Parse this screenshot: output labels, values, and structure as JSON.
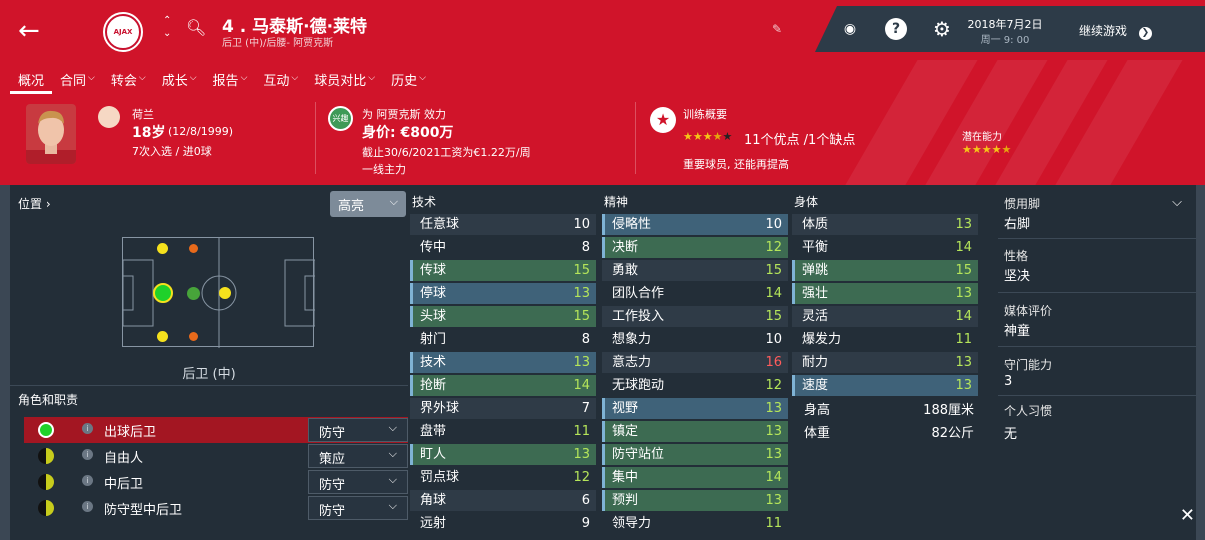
{
  "player": {
    "number_name": "4 . 马泰斯·德·莱特",
    "subtitle": "后卫 (中)/后腰- 阿贾克斯",
    "nationality": "荷兰",
    "age": "18岁",
    "dob": "(12/8/1999)",
    "caps": "7次入选 / 进0球",
    "club_line": "为 阿贾克斯 效力",
    "value": "身价: €800万",
    "contract": "截止30/6/2021工资为€1.22万/周",
    "squad_status": "一线主力",
    "club_badge_text": "兴趣"
  },
  "topbar": {
    "date": "2018年7月2日",
    "time": "周一 9: 00",
    "continue_label": "继续游戏"
  },
  "menu": [
    {
      "label": "概况",
      "active": true
    },
    {
      "label": "合同",
      "caret": true
    },
    {
      "label": "转会",
      "caret": true
    },
    {
      "label": "成长",
      "caret": true
    },
    {
      "label": "报告",
      "caret": true
    },
    {
      "label": "互动",
      "caret": true
    },
    {
      "label": "球员对比",
      "caret": true
    },
    {
      "label": "历史",
      "caret": true
    }
  ],
  "training": {
    "title": "训练概要",
    "summary": "11个优点 /1个缺点",
    "note": "重要球员, 还能再提高",
    "stars": 3.5
  },
  "potential": {
    "label": "潜在能力",
    "stars": 4.5
  },
  "positions": {
    "header": "位置",
    "highlight_label": "高亮",
    "position_label": "后卫 (中)"
  },
  "roles": {
    "header": "角色和职责",
    "items": [
      {
        "name": "出球后卫",
        "duty": "防守",
        "selected": true
      },
      {
        "name": "自由人",
        "duty": "策应",
        "selected": false
      },
      {
        "name": "中后卫",
        "duty": "防守",
        "selected": false
      },
      {
        "name": "防守型中后卫",
        "duty": "防守",
        "selected": false
      }
    ]
  },
  "attributes": {
    "technical": {
      "title": "技术",
      "items": [
        {
          "name": "任意球",
          "value": "10",
          "hl": false
        },
        {
          "name": "传中",
          "value": "8",
          "hl": false
        },
        {
          "name": "传球",
          "value": "15",
          "hl": true
        },
        {
          "name": "停球",
          "value": "13",
          "hl": true
        },
        {
          "name": "头球",
          "value": "15",
          "hl": true
        },
        {
          "name": "射门",
          "value": "8",
          "hl": false
        },
        {
          "name": "技术",
          "value": "13",
          "hl": true
        },
        {
          "name": "抢断",
          "value": "14",
          "hl": true
        },
        {
          "name": "界外球",
          "value": "7",
          "hl": false
        },
        {
          "name": "盘带",
          "value": "11",
          "hl": false
        },
        {
          "name": "盯人",
          "value": "13",
          "hl": true
        },
        {
          "name": "罚点球",
          "value": "12",
          "hl": false
        },
        {
          "name": "角球",
          "value": "6",
          "hl": false
        },
        {
          "name": "远射",
          "value": "9",
          "hl": false
        }
      ]
    },
    "mental": {
      "title": "精神",
      "items": [
        {
          "name": "侵略性",
          "value": "10",
          "hl": true
        },
        {
          "name": "决断",
          "value": "12",
          "hl": true
        },
        {
          "name": "勇敢",
          "value": "15",
          "hl": false
        },
        {
          "name": "团队合作",
          "value": "14",
          "hl": false
        },
        {
          "name": "工作投入",
          "value": "15",
          "hl": false
        },
        {
          "name": "想象力",
          "value": "10",
          "hl": false
        },
        {
          "name": "意志力",
          "value": "16",
          "hl": false
        },
        {
          "name": "无球跑动",
          "value": "12",
          "hl": false
        },
        {
          "name": "视野",
          "value": "13",
          "hl": true
        },
        {
          "name": "镇定",
          "value": "13",
          "hl": true
        },
        {
          "name": "防守站位",
          "value": "13",
          "hl": true
        },
        {
          "name": "集中",
          "value": "14",
          "hl": true
        },
        {
          "name": "预判",
          "value": "13",
          "hl": true
        },
        {
          "name": "领导力",
          "value": "11",
          "hl": false
        }
      ]
    },
    "physical": {
      "title": "身体",
      "items": [
        {
          "name": "体质",
          "value": "13",
          "hl": false
        },
        {
          "name": "平衡",
          "value": "14",
          "hl": false
        },
        {
          "name": "弹跳",
          "value": "15",
          "hl": true
        },
        {
          "name": "强壮",
          "value": "13",
          "hl": true
        },
        {
          "name": "灵活",
          "value": "14",
          "hl": false
        },
        {
          "name": "爆发力",
          "value": "11",
          "hl": false
        },
        {
          "name": "耐力",
          "value": "13",
          "hl": false
        },
        {
          "name": "速度",
          "value": "13",
          "hl": true
        }
      ],
      "height_label": "身高",
      "height_value": "188厘米",
      "weight_label": "体重",
      "weight_value": "82公斤"
    }
  },
  "info": {
    "foot_label": "惯用脚",
    "foot_value": "右脚",
    "personality_label": "性格",
    "personality_value": "坚决",
    "media_label": "媒体评价",
    "media_value": "神童",
    "gk_label": "守门能力",
    "gk_value": "3",
    "habits_label": "个人习惯",
    "habits_value": "无"
  },
  "colors": {
    "header_red": "#d0142a",
    "highlight_green": "#3d6b52",
    "highlight_blue": "#3f6279",
    "value_green": "#b5e55a",
    "value_red": "#ff5c5c"
  }
}
